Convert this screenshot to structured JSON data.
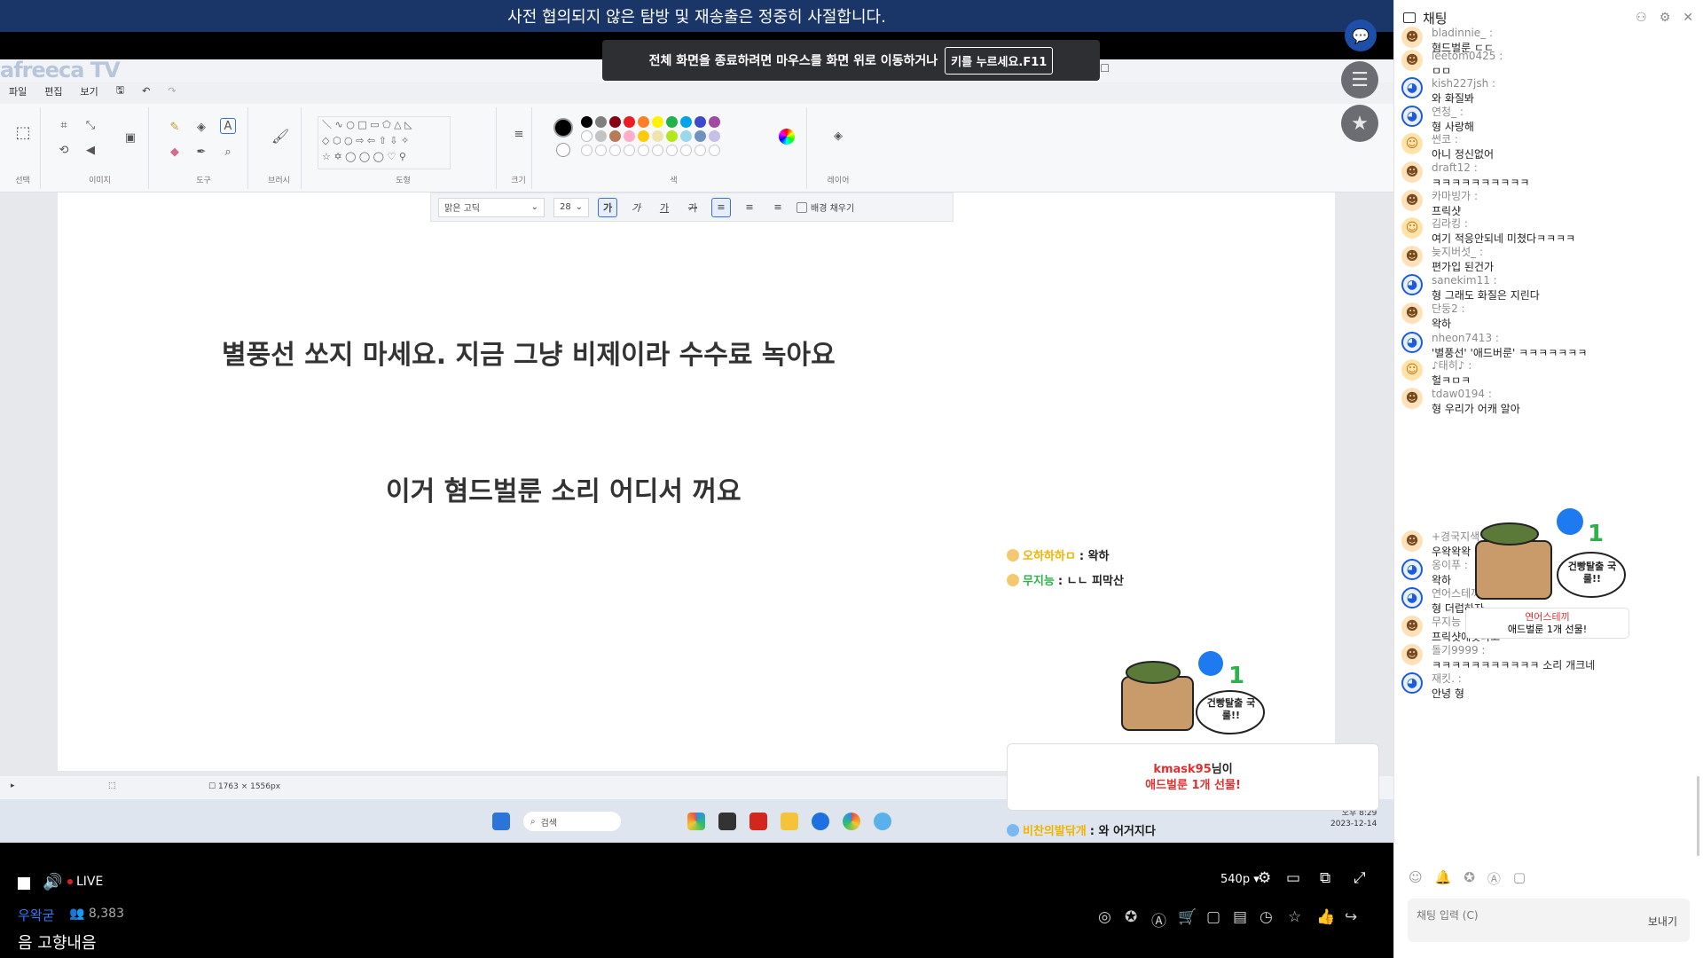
{
  "warning_bar": "사전 협의되지 않은 탐방 및 재송출은 정중히 사절합니다.",
  "fs_toast": {
    "text": "전체 화면을 종료하려면 마우스를 화면 위로 이동하거나",
    "key": "키를 누르세요.F11"
  },
  "paint": {
    "logo": "afreeca TV",
    "menu": [
      "파일",
      "편집",
      "보기"
    ],
    "groups": [
      "선택",
      "이미지",
      "도구",
      "브러시",
      "도형",
      "크기",
      "색",
      "레이어"
    ],
    "font_name": "맑은 고딕",
    "font_size": "28",
    "bg_fill": "배경 채우기",
    "line1": "별풍선 쏘지 마세요. 지금 그냥 비제이라 수수료 녹아요",
    "line2": "이거 혐드벌룬 소리 어디서 꺼요",
    "status_size": "1763 × 1556px",
    "taskbar_search": "검색",
    "clock_time": "오후 8:29",
    "clock_date": "2023-12-14",
    "colors": [
      "#000000",
      "#7f7f7f",
      "#880015",
      "#ed1c24",
      "#ff7f27",
      "#fff200",
      "#22b14c",
      "#00a2e8",
      "#3f48cc",
      "#a349a4",
      "#ffffff",
      "#c3c3c3",
      "#b97a57",
      "#ffaec9",
      "#ffc90e",
      "#efe4b0",
      "#b5e61d",
      "#99d9ea",
      "#7092be",
      "#c8bfe7"
    ]
  },
  "overlay": {
    "chat1_name": "오하하하ㅁ",
    "chat1_text": ": 왁하",
    "chat2_name": "무지능",
    "chat2_text": ": ㄴㄴ 피막산",
    "gift_name": "kmask95",
    "gift_nim": "님이",
    "gift_desc": "애드벌룬 1개 선물!",
    "gift_sticker": "건빵탈출 국룰!!",
    "bottom_chat_name": "비찬의발닦개",
    "bottom_chat_text": ": 와 어거지다"
  },
  "controls": {
    "live": "LIVE",
    "quality": "540p"
  },
  "stream": {
    "streamer": "우왁굳",
    "viewers": "8,383",
    "title": "음 고향내음"
  },
  "chat": {
    "title": "채팅",
    "input_placeholder": "채팅 입력 (C)",
    "send": "보내기",
    "messages": [
      {
        "name": "bladinnie_",
        "text": "혐드벌룬 ㄷㄷ",
        "ava": "kid"
      },
      {
        "name": "leetom0425",
        "text": "ㅁㅁ",
        "ava": "kid"
      },
      {
        "name": "kish227jsh",
        "text": "와 화질봐",
        "ava": "dog"
      },
      {
        "name": "연청_",
        "text": "형 사랑해",
        "ava": "dog"
      },
      {
        "name": "썬코",
        "text": "아니 정신없어",
        "ava": "girl"
      },
      {
        "name": "draft12",
        "text": "ㅋㅋㅋㅋㅋㅋㅋㅋㅋㅋ",
        "ava": "kid"
      },
      {
        "name": "카마빙가",
        "text": "프릭샷",
        "ava": "kid"
      },
      {
        "name": "김라킹",
        "text": "여기 적응안되네 미쳤다ㅋㅋㅋㅋ",
        "ava": "girl"
      },
      {
        "name": "늦지버섯_",
        "text": "편가입 된건가",
        "ava": "kid"
      },
      {
        "name": "sanekim11",
        "text": "형 그래도 화질은 지린다",
        "ava": "dog"
      },
      {
        "name": "단둥2",
        "text": "왁하",
        "ava": "kid"
      },
      {
        "name": "nheon7413",
        "text": "'별풍선' '애드버룬' ㅋㅋㅋㅋㅋㅋㅋ",
        "ava": "dog"
      },
      {
        "name": "♪태히♪",
        "text": "헐ㅋㅁㅋ",
        "ava": "girl"
      },
      {
        "name": "tdaw0194",
        "text": "형 우리가 어캐 알아",
        "ava": "kid"
      },
      {
        "name": "+경국지색",
        "text": "우왁왁왁",
        "ava": "kid"
      },
      {
        "name": "옹이푸",
        "text": "왁하",
        "ava": "dog"
      },
      {
        "name": "연어스테끼",
        "text": "형 더럽하자",
        "ava": "dog"
      },
      {
        "name": "무지능",
        "text": "프릭샷에잇다고",
        "ava": "kid"
      },
      {
        "name": "돌기9999",
        "text": "ㅋㅋㅋㅋㅋㅋㅋㅋㅋㅋㅋ 소리 개크네",
        "ava": "kid"
      },
      {
        "name": "재킷.",
        "text": "안녕 형",
        "ava": "dog"
      }
    ],
    "gift": {
      "sticker": "건빵탈출 국룰!!",
      "name": "연어스테끼",
      "desc": "애드벌룬 1개 선물!"
    }
  }
}
